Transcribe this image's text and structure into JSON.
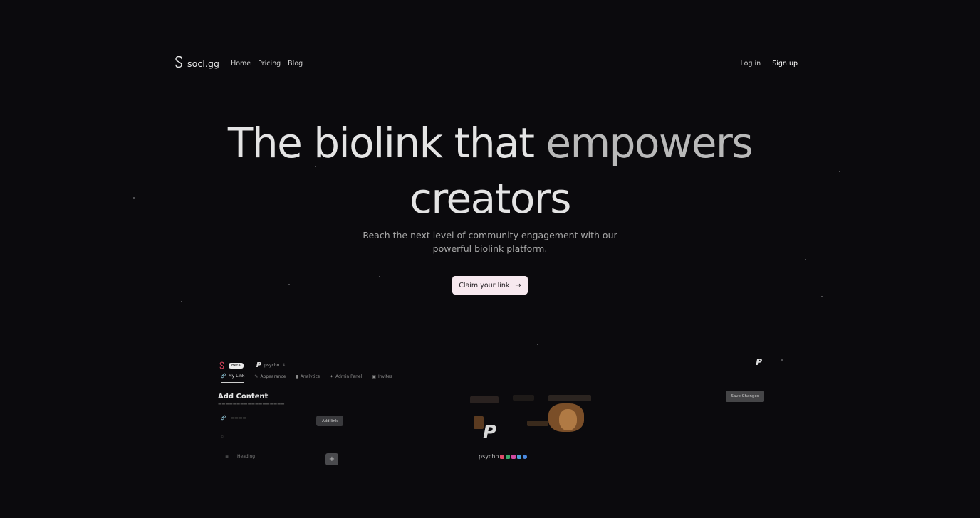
{
  "nav": {
    "logo_text": "socl.gg",
    "links": [
      "Home",
      "Pricing",
      "Blog"
    ],
    "login": "Log in",
    "signup": "Sign up"
  },
  "hero": {
    "title_line1_a": "The biolink that",
    "title_line1_b": "empowers",
    "title_line2": "creators",
    "subtitle_line1": "Reach the next level of community engagement with our",
    "subtitle_line2": "powerful biolink platform.",
    "cta_label": "Claim your link"
  },
  "preview": {
    "beta": "Beta",
    "username": "psycho",
    "tabs": [
      {
        "label": "My Link",
        "icon": "link-icon"
      },
      {
        "label": "Appearance",
        "icon": "brush-icon"
      },
      {
        "label": "Analytics",
        "icon": "bar-chart-icon"
      },
      {
        "label": "Admin Panel",
        "icon": "wrench-icon"
      },
      {
        "label": "Invites",
        "icon": "gift-icon"
      }
    ],
    "add_content": "Add Content",
    "add_link_label": "Add link",
    "heading_label": "Heading",
    "save_label": "Save Changes",
    "profile_name": "psycho"
  },
  "colors": {
    "background": "#0b0a0d",
    "cta_bg": "#f7e9ef",
    "brand_red": "#e0455f"
  }
}
